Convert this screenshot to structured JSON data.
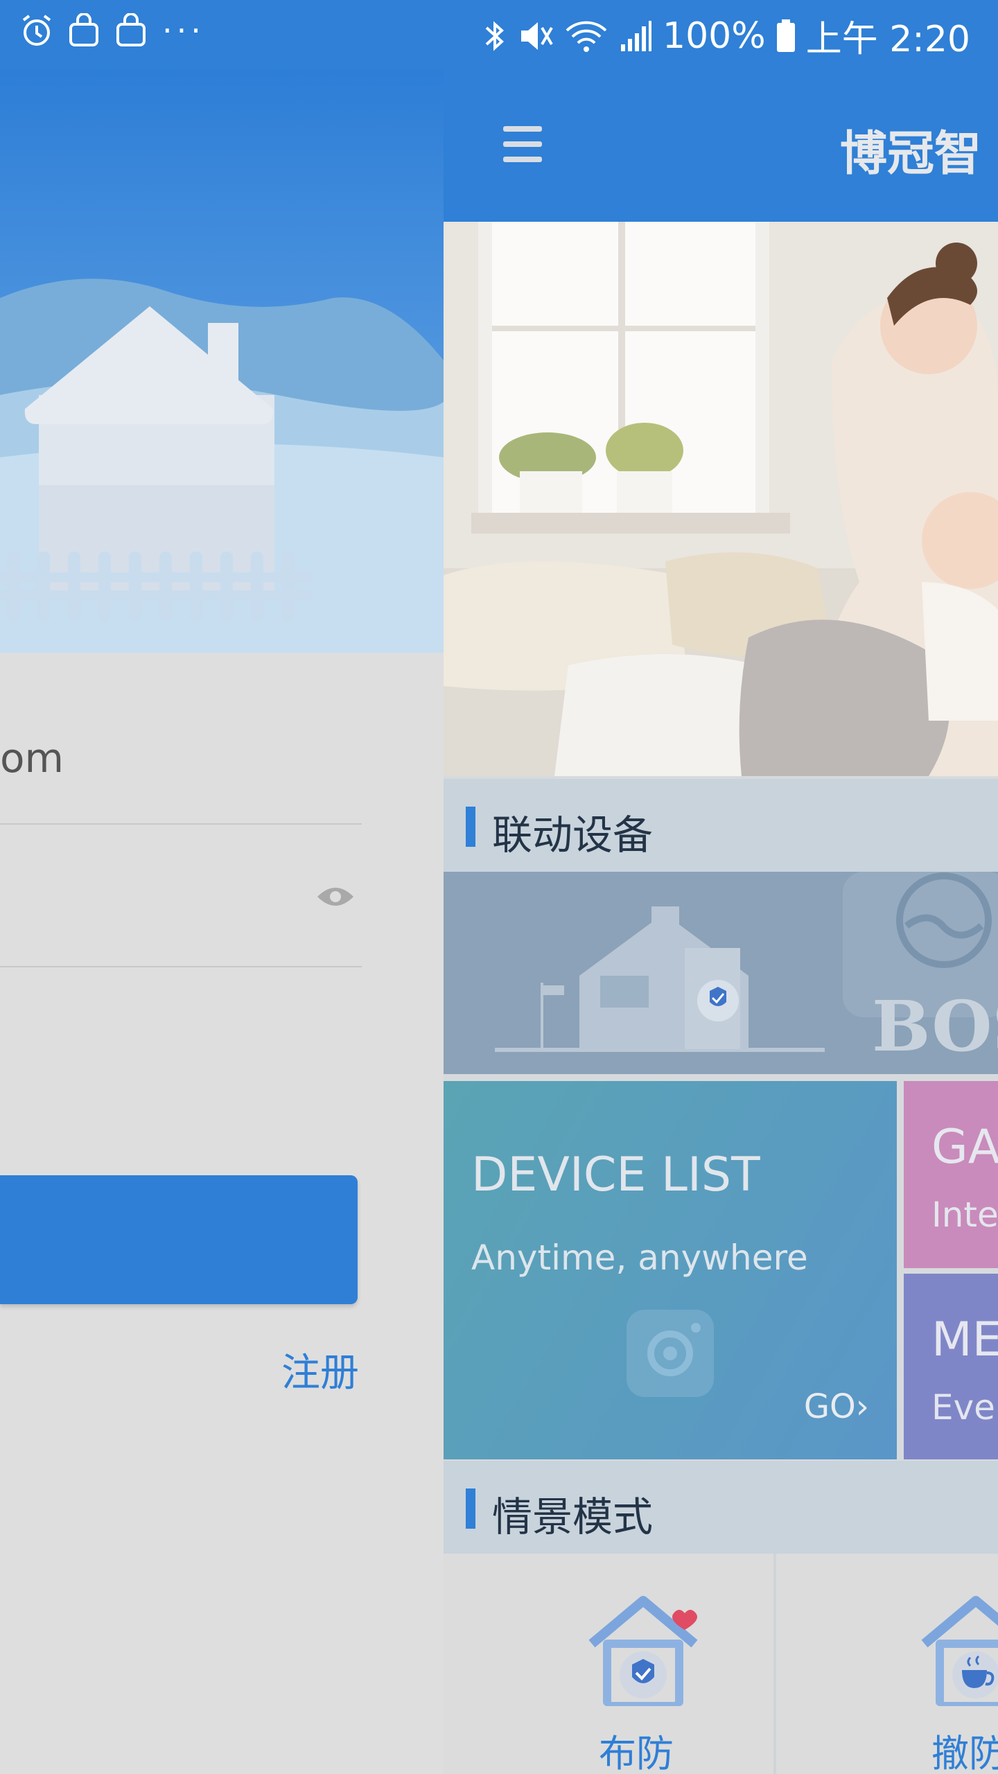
{
  "status_bar": {
    "battery": "100%",
    "time": "上午 2:20",
    "left_icons": [
      "alarm-icon",
      "bag-icon",
      "bag-icon"
    ],
    "more": "···"
  },
  "drawer": {
    "account_fragment": "om",
    "register_label": "注册"
  },
  "header": {
    "title": "博冠智"
  },
  "sections": {
    "linked_devices": "联动设备",
    "scene_mode": "情景模式"
  },
  "linked_banner": {
    "brand_fragment": "BOS"
  },
  "cards": {
    "device": {
      "title": "DEVICE LIST",
      "subtitle": "Anytime, anywhere",
      "go": "GO"
    },
    "game": {
      "title": "GA",
      "subtitle": "Inte"
    },
    "message": {
      "title": "ME",
      "subtitle": "Ever"
    }
  },
  "scenes": [
    {
      "label": "布防",
      "icon": "shield-house-icon"
    },
    {
      "label": "撤防",
      "icon": "cup-house-icon"
    }
  ],
  "colors": {
    "primary": "#2f80d6",
    "scene_label": "#2f7fd6",
    "heart": "#e04c63"
  }
}
